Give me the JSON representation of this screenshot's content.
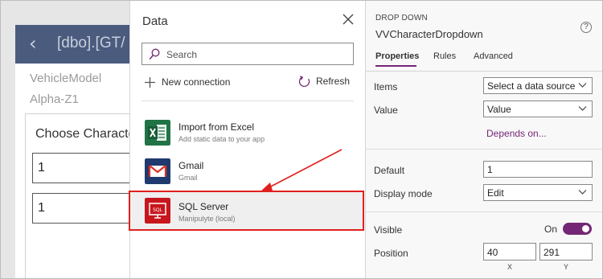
{
  "canvas": {
    "header_title": "[dbo].[GT/",
    "field_label": "VehicleModel",
    "field_value": "Alpha-Z1",
    "card_title": "Choose Characte",
    "input1_value": "1",
    "input2_value": "1"
  },
  "data_pane": {
    "title": "Data",
    "search_placeholder": "Search",
    "new_connection_label": "New connection",
    "refresh_label": "Refresh",
    "sources": [
      {
        "name": "Import from Excel",
        "subtitle": "Add static data to your app",
        "icon": "excel-icon"
      },
      {
        "name": "Gmail",
        "subtitle": "Gmail",
        "icon": "gmail-icon"
      },
      {
        "name": "SQL Server",
        "subtitle": "Manipulyte (local)",
        "icon": "sql-server-icon"
      }
    ]
  },
  "properties": {
    "control_type": "DROP DOWN",
    "control_name": "VVCharacterDropdown",
    "tabs": [
      "Properties",
      "Rules",
      "Advanced"
    ],
    "items_label": "Items",
    "items_value": "Select a data source",
    "value_label": "Value",
    "value_value": "Value",
    "depends_link": "Depends on...",
    "default_label": "Default",
    "default_value": "1",
    "display_mode_label": "Display mode",
    "display_mode_value": "Edit",
    "visible_label": "Visible",
    "visible_state": "On",
    "position_label": "Position",
    "position_x": "40",
    "position_y": "291",
    "x_caption": "X",
    "y_caption": "Y"
  },
  "colors": {
    "accent_purple": "#742774",
    "highlight_red": "#e0201f",
    "excel_green": "#217346",
    "gmail_blue": "#1f3a6e",
    "sql_red": "#c8161d",
    "app_header": "#4b5b7e"
  }
}
